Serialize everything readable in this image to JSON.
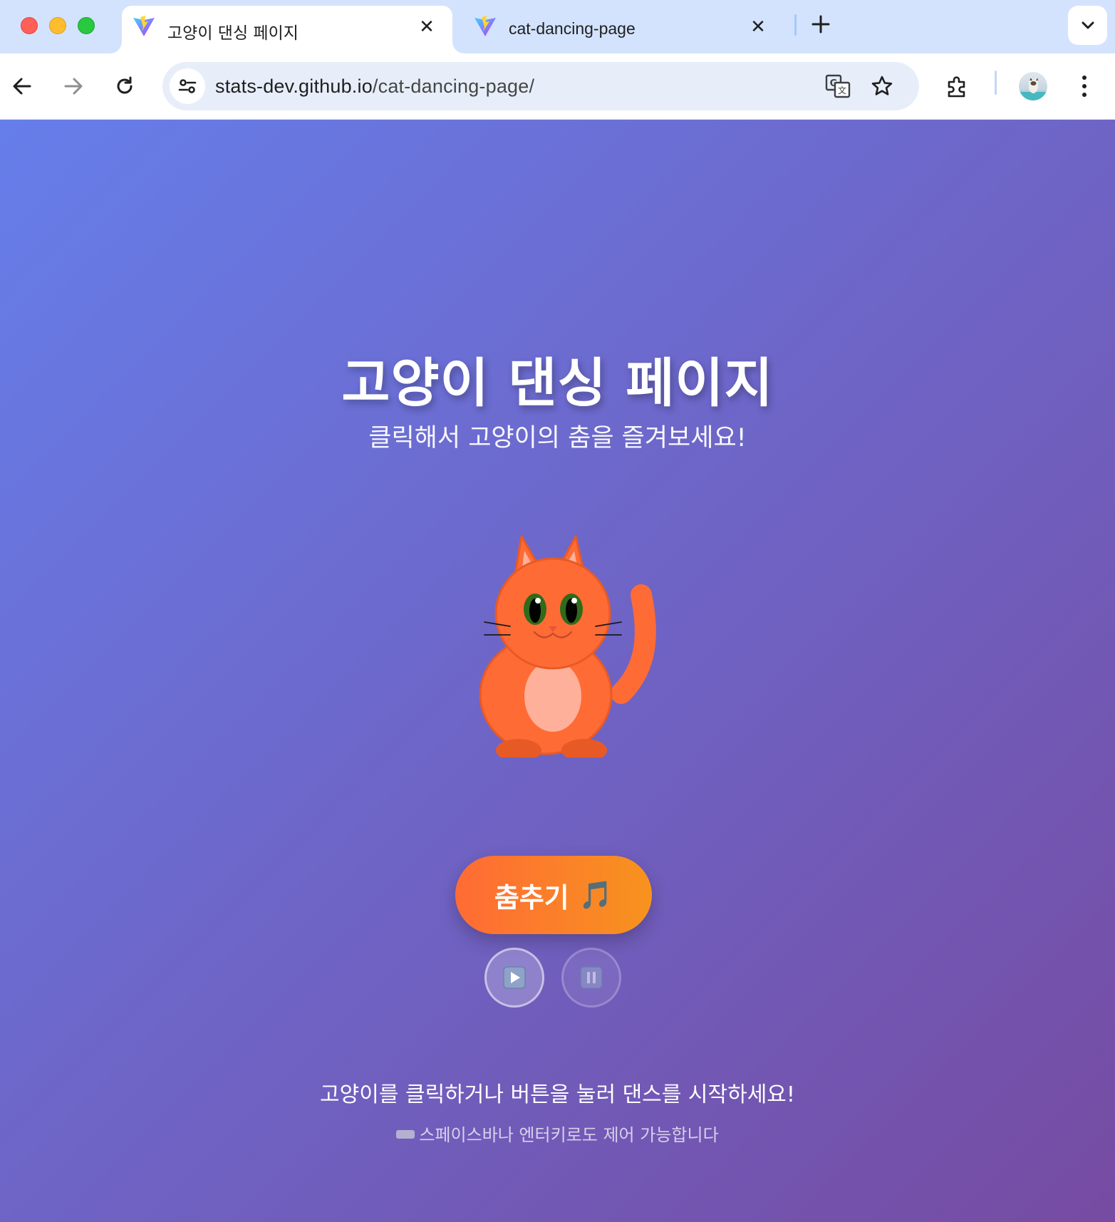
{
  "browser": {
    "tabs": [
      {
        "title": "고양이 댄싱 페이지",
        "active": true
      },
      {
        "title": "cat-dancing-page",
        "active": false
      }
    ],
    "url": {
      "host": "stats-dev.github.io",
      "path": "/cat-dancing-page/"
    },
    "icons": {
      "back": "arrow-left-icon",
      "forward": "arrow-right-icon",
      "reload": "reload-icon",
      "site_info": "tune-icon",
      "translate": "translate-icon",
      "bookmark": "star-icon",
      "extensions": "puzzle-icon",
      "menu": "kebab-menu-icon",
      "tab_search": "chevron-down-icon",
      "new_tab": "plus-icon"
    }
  },
  "page": {
    "title": "고양이 댄싱 페이지",
    "subtitle": "클릭해서 고양이의 춤을 즐겨보세요!",
    "dance_button": {
      "label": "춤추기",
      "emoji": "🎵"
    },
    "controls": {
      "play_icon": "▶",
      "pause_icon": "⏸"
    },
    "instructions": "고양이를 클릭하거나 버튼을 눌러 댄스를 시작하세요!",
    "hint": "스페이스바나 엔터키로도 제어 가능합니다"
  },
  "colors": {
    "bg_start": "#667eea",
    "bg_end": "#764ba2",
    "cat_body": "#ff6b35",
    "cat_belly": "#ffb09a",
    "button_start": "#ff6b35",
    "button_end": "#f7931e"
  }
}
